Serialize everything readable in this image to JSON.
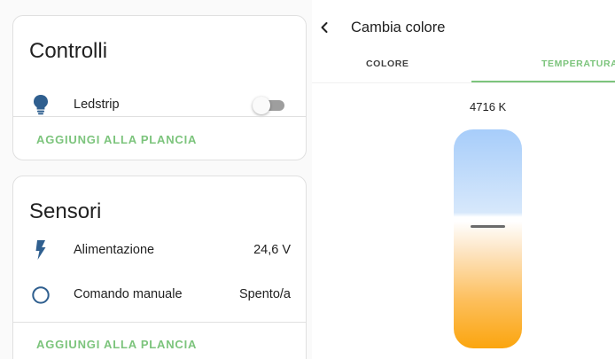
{
  "controls_card": {
    "title": "Controlli",
    "entity": {
      "label": "Ledstrip",
      "icon": "lightbulb-icon",
      "state_on": false
    },
    "action": "AGGIUNGI ALLA PLANCIA"
  },
  "sensors_card": {
    "title": "Sensori",
    "rows": [
      {
        "label": "Alimentazione",
        "value": "24,6 V",
        "icon": "flash-icon"
      },
      {
        "label": "Comando manuale",
        "value": "Spento/a",
        "icon": "circle-outline-icon"
      }
    ],
    "action": "AGGIUNGI ALLA PLANCIA"
  },
  "color_dialog": {
    "back_icon": "chevron-left-icon",
    "title": "Cambia colore",
    "tabs": [
      {
        "label": "COLORE",
        "active": false
      },
      {
        "label": "TEMPERATURA",
        "active": true
      }
    ],
    "kelvin_label": "4716 K",
    "slider_level": 0.44
  },
  "colors": {
    "accent": "#7cc47c",
    "icon_blue": "#2f5f8f",
    "cold": "#a7cdfa",
    "warm": "#fba50e"
  }
}
